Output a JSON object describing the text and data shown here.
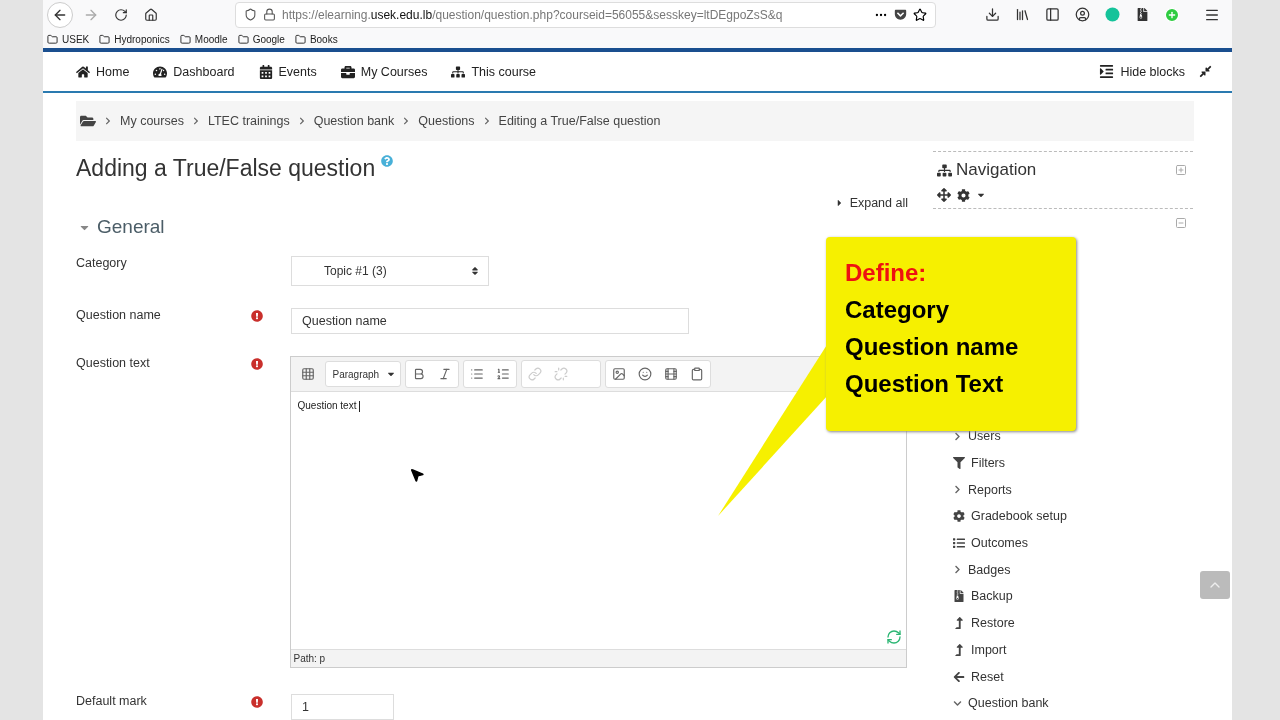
{
  "browser": {
    "url_prefix": "https://elearning.",
    "url_domain": "usek.edu.lb",
    "url_rest": "/question/question.php?courseid=56055&sesskey=ltDEgpoZsS&q",
    "bookmarks": [
      "USEK",
      "Hydroponics",
      "Moodle",
      "Google",
      "Books"
    ]
  },
  "navbar": {
    "items": [
      {
        "kind": "home",
        "label": "Home"
      },
      {
        "kind": "dashboard",
        "label": "Dashboard"
      },
      {
        "kind": "calendar",
        "label": "Events"
      },
      {
        "kind": "briefcase",
        "label": "My Courses"
      },
      {
        "kind": "sitemap",
        "label": "This course"
      }
    ],
    "hide_blocks": "Hide blocks"
  },
  "breadcrumb": [
    "My courses",
    "LTEC trainings",
    "Question bank",
    "Questions",
    "Editing a True/False question"
  ],
  "page_title": "Adding a True/False question",
  "expand_all": "Expand all",
  "section": {
    "title": "General",
    "expanded": true
  },
  "fields": [
    {
      "kind": "select",
      "label": "Category",
      "required": false,
      "value": "Topic #1 (3)"
    },
    {
      "kind": "text",
      "label": "Question name",
      "required": true,
      "value": "Question name"
    },
    {
      "kind": "editor",
      "label": "Question text",
      "required": true,
      "format": "Paragraph",
      "value": "Question text",
      "path": "Path: p"
    },
    {
      "kind": "short",
      "label": "Default mark",
      "required": true,
      "value": "1"
    }
  ],
  "navigation": {
    "title": "Navigation",
    "items": [
      {
        "kind": "branch",
        "label": "Users",
        "expanded": false
      },
      {
        "kind": "filter",
        "label": "Filters"
      },
      {
        "kind": "branch",
        "label": "Reports",
        "expanded": false
      },
      {
        "kind": "gear",
        "label": "Gradebook setup"
      },
      {
        "kind": "list",
        "label": "Outcomes"
      },
      {
        "kind": "branch",
        "label": "Badges",
        "expanded": false
      },
      {
        "kind": "file",
        "label": "Backup"
      },
      {
        "kind": "upload",
        "label": "Restore"
      },
      {
        "kind": "upload",
        "label": "Import"
      },
      {
        "kind": "back",
        "label": "Reset"
      },
      {
        "kind": "branch",
        "label": "Question bank",
        "expanded": true
      }
    ]
  },
  "callout": {
    "heading": "Define:",
    "lines": [
      "Category",
      "Question name",
      "Question Text"
    ]
  }
}
